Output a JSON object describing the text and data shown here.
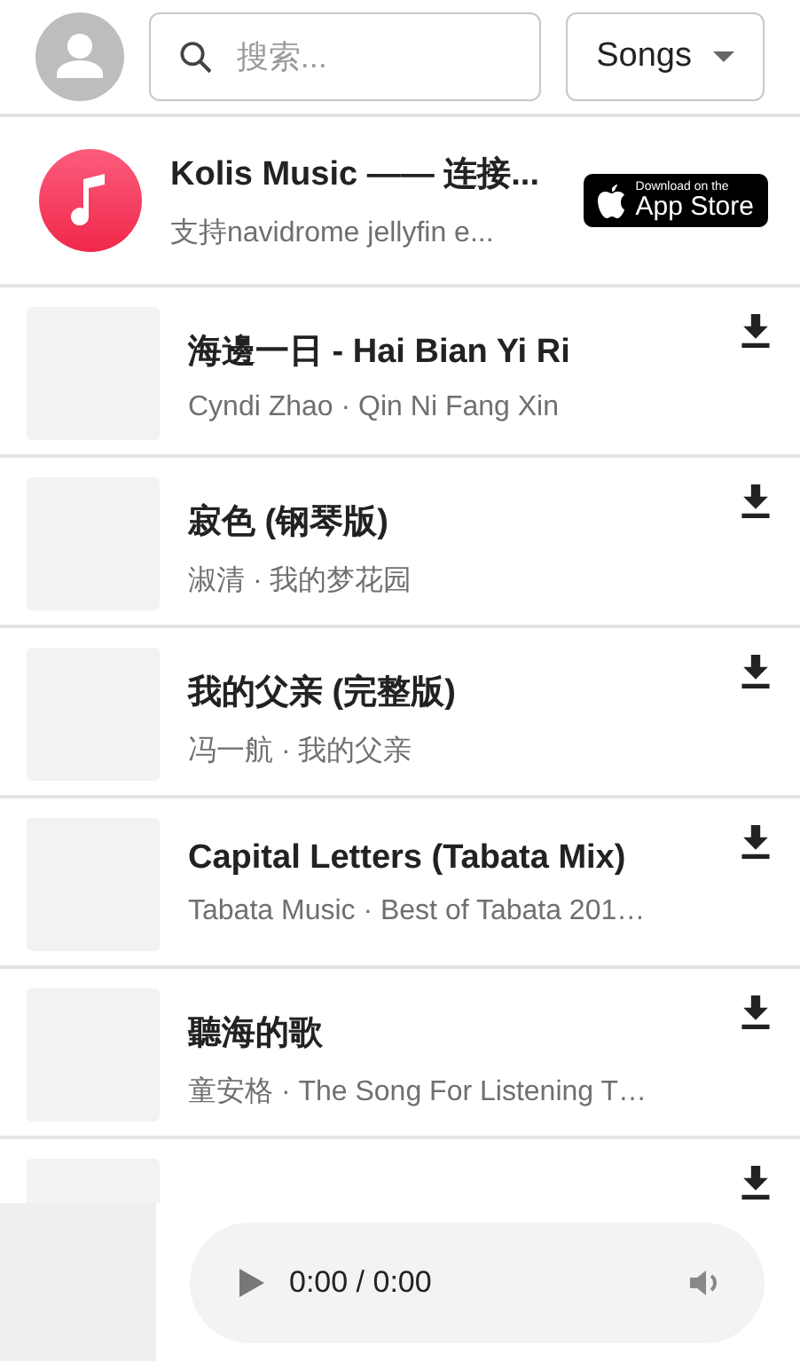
{
  "header": {
    "search": {
      "placeholder": "搜索..."
    },
    "filter": {
      "label": "Songs"
    }
  },
  "ad": {
    "title": "Kolis Music —— 连接...",
    "subtitle": "支持navidrome jellyfin e...",
    "badge_small": "Download on the",
    "badge_large": "App Store"
  },
  "songs": [
    {
      "kind": "song",
      "title": "海邊一日 - Hai Bian Yi Ri",
      "subtitle": "Cyndi Zhao · Qin Ni Fang Xin"
    },
    {
      "kind": "song",
      "title": "寂色 (钢琴版)",
      "subtitle": "淑清 · 我的梦花园"
    },
    {
      "kind": "song",
      "title": "我的父亲 (完整版)",
      "subtitle": "冯一航 · 我的父亲"
    },
    {
      "kind": "song",
      "title": "Capital Letters (Tabata Mix)",
      "subtitle": "Tabata Music · Best of Tabata 201…"
    },
    {
      "kind": "song",
      "title": "聽海的歌",
      "subtitle": "童安格 · The Song For Listening T…"
    },
    {
      "kind": "covered"
    }
  ],
  "player": {
    "time": "0:00 / 0:00"
  }
}
